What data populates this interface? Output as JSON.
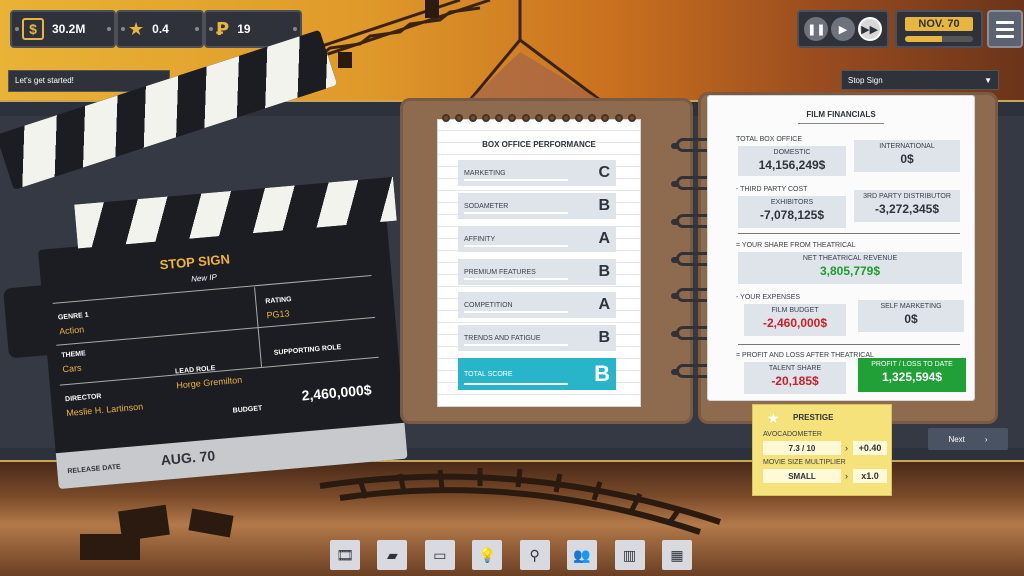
{
  "hud": {
    "money": "30.2M",
    "stars": "0.4",
    "research": "19",
    "date": "NOV. 70",
    "date_progress": 0.55
  },
  "tip": "Let's get started!",
  "film_select": "Stop Sign",
  "clapper": {
    "title": "STOP SIGN",
    "subtitle": "New IP",
    "genre_label": "GENRE 1",
    "genre": "Action",
    "rating_label": "RATING",
    "rating": "PG13",
    "theme_label": "THEME",
    "theme": "Cars",
    "lead_label": "LEAD ROLE",
    "lead": "Horge Gremilton",
    "supporting_label": "SUPPORTING ROLE",
    "director_label": "DIRECTOR",
    "director": "Meslie H. Lartinson",
    "budget_label": "BUDGET",
    "budget": "2,460,000$",
    "release_label": "RELEASE DATE",
    "release": "AUG. 70"
  },
  "box_office": {
    "title": "BOX OFFICE PERFORMANCE",
    "rows": [
      {
        "label": "MARKETING",
        "grade": "C"
      },
      {
        "label": "SODAMETER",
        "grade": "B"
      },
      {
        "label": "AFFINITY",
        "grade": "A"
      },
      {
        "label": "PREMIUM FEATURES",
        "grade": "B"
      },
      {
        "label": "COMPETITION",
        "grade": "A"
      },
      {
        "label": "TRENDS AND FATIGUE",
        "grade": "B"
      },
      {
        "label": "TOTAL SCORE",
        "grade": "B"
      }
    ]
  },
  "financials": {
    "title": "FILM FINANCIALS",
    "total_box_office": "TOTAL BOX OFFICE",
    "domestic_label": "DOMESTIC",
    "domestic": "14,156,249$",
    "international_label": "INTERNATIONAL",
    "international": "0$",
    "third_party": "- THIRD PARTY COST",
    "exhibitors_label": "EXHIBITORS",
    "exhibitors": "-7,078,125$",
    "distributor_label": "3RD PARTY DISTRIBUTOR",
    "distributor": "-3,272,345$",
    "share_theatrical": "= YOUR SHARE FROM THEATRICAL",
    "net_label": "NET THEATRICAL REVENUE",
    "net": "3,805,779$",
    "expenses": "- YOUR EXPENSES",
    "film_budget_label": "FILM BUDGET",
    "film_budget": "-2,460,000$",
    "self_marketing_label": "SELF MARKETING",
    "self_marketing": "0$",
    "pnl": "= PROFIT AND LOSS AFTER THEATRICAL",
    "talent_label": "TALENT SHARE",
    "talent": "-20,185$",
    "profit_label": "PROFIT / LOSS TO DATE",
    "profit": "1,325,594$"
  },
  "prestige": {
    "title": "PRESTIGE",
    "avocado_label": "AVOCADOMETER",
    "avocado": "7.3 / 10",
    "avocado_mod": "+0.40",
    "size_label": "MOVIE SIZE MULTIPLIER",
    "size": "SMALL",
    "size_mod": "x1.0"
  },
  "next_label": "Next",
  "colors": {
    "accent": "#e7b640",
    "total_score": "#29b5c9",
    "profit": "#21a038",
    "negative": "#c8202a"
  },
  "toolbar_icons": [
    "film-icon",
    "folder-icon",
    "tv-icon",
    "lightbulb-icon",
    "search-icon",
    "people-icon",
    "chart-icon",
    "building-icon"
  ]
}
